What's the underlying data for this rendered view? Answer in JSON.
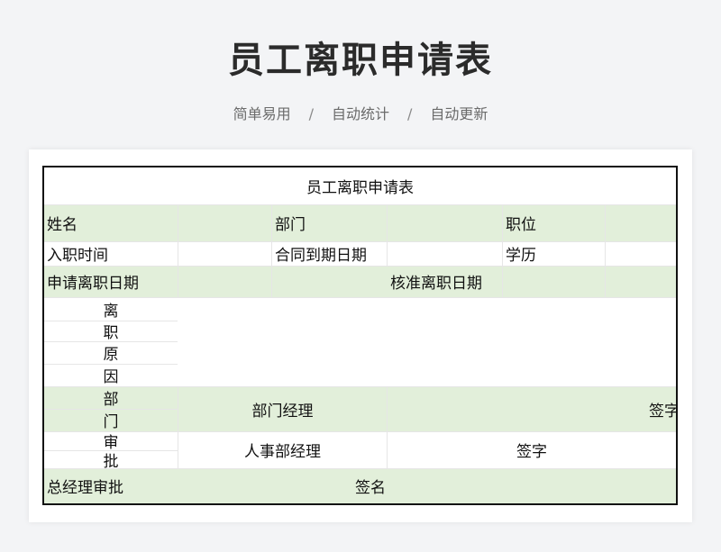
{
  "page": {
    "title": "员工离职申请表",
    "subtitle": [
      "简单易用",
      "自动统计",
      "自动更新"
    ],
    "separator": "/"
  },
  "form": {
    "title": "员工离职申请表",
    "row_name": {
      "name": "姓名",
      "dept": "部门",
      "position": "职位"
    },
    "row_join": {
      "join_date": "入职时间",
      "contract_end": "合同到期日期",
      "education": "学历"
    },
    "row_apply": {
      "apply_date": "申请离职日期",
      "approve_date": "核准离职日期"
    },
    "reason_chars": [
      "离",
      "职",
      "原",
      "因"
    ],
    "dept_chars": [
      "部",
      "门"
    ],
    "dept_manager": "部门经理",
    "dept_sign": "签字",
    "approve_chars": [
      "审",
      "批"
    ],
    "hr_manager": "人事部经理",
    "hr_sign": "签字",
    "gm_approval": "总经理审批",
    "gm_sign": "签名"
  },
  "colors": {
    "highlight_green": "#e2efda",
    "border": "#111111",
    "background": "#f3f4f6"
  }
}
